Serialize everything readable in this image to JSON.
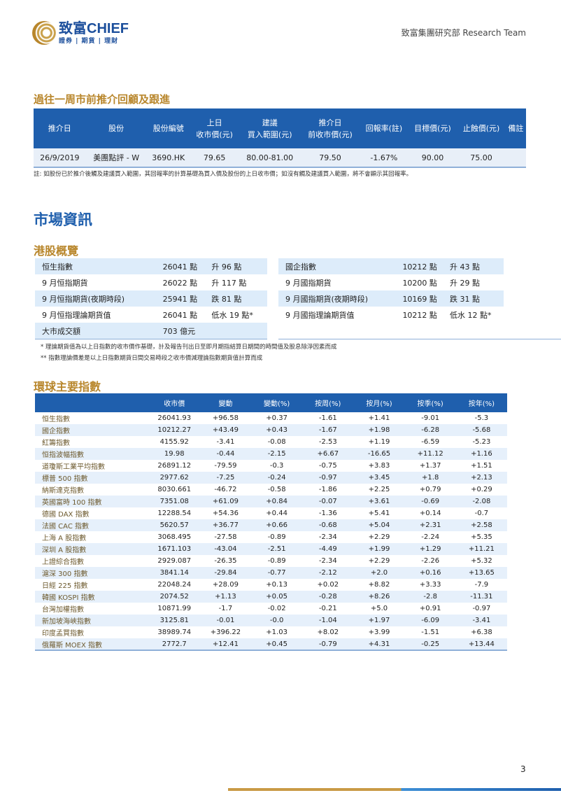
{
  "header": {
    "logo_cn": "致富",
    "logo_en": "CHIEF",
    "logo_sub": "證券 | 期貨 | 理財",
    "right": "致富集團研究部  Research Team"
  },
  "recap": {
    "title": "過往一周市前推介回顧及跟進",
    "columns": [
      "推介日",
      "股份",
      "股份編號",
      "上日\n收市價(元)",
      "建議\n買入範圍(元)",
      "推介日\n前收市價(元)",
      "回報率(註)",
      "目標價(元)",
      "止蝕價(元)",
      "備註"
    ],
    "rows": [
      [
        "26/9/2019",
        "美團點評 - W",
        "3690.HK",
        "79.65",
        "80.00-81.00",
        "79.50",
        "-1.67%",
        "90.00",
        "75.00",
        ""
      ]
    ],
    "note": "註: 如股份已於推介後觸及建議買入範圍，其回報率的計算基礎為買入價及股份的上日收市價；如沒有觸及建議買入範圍，將不會顯示其回報率。"
  },
  "market": {
    "title": "市場資訊"
  },
  "hk": {
    "title": "港股概覽",
    "left": [
      [
        "恒生指數",
        "26041 點",
        "升 96 點"
      ],
      [
        "9 月恒指期貨",
        "26022 點",
        "升 117 點"
      ],
      [
        "9 月恒指期貨(夜期時段)",
        "25941 點",
        "跌 81 點"
      ],
      [
        "9 月恒指理論期貨值",
        "26041 點",
        "低水 19 點*"
      ],
      [
        "大市成交額",
        "703 億元",
        ""
      ]
    ],
    "right": [
      [
        "國企指數",
        "10212 點",
        "升 43 點"
      ],
      [
        "9 月國指期貨",
        "10200 點",
        "升 29 點"
      ],
      [
        "9 月國指期貨(夜期時段)",
        "10169 點",
        "跌 31 點"
      ],
      [
        "9 月國指理論期貨值",
        "10212 點",
        "低水 12 點*"
      ]
    ],
    "footnotes": [
      "*  理論期貨值為以上日指數的收市價作基礎，計及報告刊出日至即月期指結算日期間的時間值及股息除淨因素而成",
      "** 指數理論價差是以上日指數期貨日間交易時段之收市價減理論指數期貨值計算而成"
    ]
  },
  "global": {
    "title": "環球主要指數",
    "columns": [
      "",
      "收市價",
      "變動",
      "變動(%)",
      "按周(%)",
      "按月(%)",
      "按季(%)",
      "按年(%)"
    ],
    "rows": [
      [
        "恒生指數",
        "26041.93",
        "+96.58",
        "+0.37",
        "-1.61",
        "+1.41",
        "-9.01",
        "-5.3"
      ],
      [
        "國企指數",
        "10212.27",
        "+43.49",
        "+0.43",
        "-1.67",
        "+1.98",
        "-6.28",
        "-5.68"
      ],
      [
        "紅籌指數",
        "4155.92",
        "-3.41",
        "-0.08",
        "-2.53",
        "+1.19",
        "-6.59",
        "-5.23"
      ],
      [
        "恒指波幅指數",
        "19.98",
        "-0.44",
        "-2.15",
        "+6.67",
        "-16.65",
        "+11.12",
        "+1.16"
      ],
      [
        "道瓊斯工業平均指數",
        "26891.12",
        "-79.59",
        "-0.3",
        "-0.75",
        "+3.83",
        "+1.37",
        "+1.51"
      ],
      [
        "標普 500 指數",
        "2977.62",
        "-7.25",
        "-0.24",
        "-0.97",
        "+3.45",
        "+1.8",
        "+2.13"
      ],
      [
        "納斯達克指數",
        "8030.661",
        "-46.72",
        "-0.58",
        "-1.86",
        "+2.25",
        "+0.79",
        "+0.29"
      ],
      [
        "英國富時 100 指數",
        "7351.08",
        "+61.09",
        "+0.84",
        "-0.07",
        "+3.61",
        "-0.69",
        "-2.08"
      ],
      [
        "德國 DAX 指數",
        "12288.54",
        "+54.36",
        "+0.44",
        "-1.36",
        "+5.41",
        "+0.14",
        "-0.7"
      ],
      [
        "法國 CAC 指數",
        "5620.57",
        "+36.77",
        "+0.66",
        "-0.68",
        "+5.04",
        "+2.31",
        "+2.58"
      ],
      [
        "上海 A 股指數",
        "3068.495",
        "-27.58",
        "-0.89",
        "-2.34",
        "+2.29",
        "-2.24",
        "+5.35"
      ],
      [
        "深圳 A 股指數",
        "1671.103",
        "-43.04",
        "-2.51",
        "-4.49",
        "+1.99",
        "+1.29",
        "+11.21"
      ],
      [
        "上證綜合指數",
        "2929.087",
        "-26.35",
        "-0.89",
        "-2.34",
        "+2.29",
        "-2.26",
        "+5.32"
      ],
      [
        "滬深 300 指數",
        "3841.14",
        "-29.84",
        "-0.77",
        "-2.12",
        "+2.0",
        "+0.16",
        "+13.65"
      ],
      [
        "日經 225 指數",
        "22048.24",
        "+28.09",
        "+0.13",
        "+0.02",
        "+8.82",
        "+3.33",
        "-7.9"
      ],
      [
        "韓國 KOSPI 指數",
        "2074.52",
        "+1.13",
        "+0.05",
        "-0.28",
        "+8.26",
        "-2.8",
        "-11.31"
      ],
      [
        "台灣加權指數",
        "10871.99",
        "-1.7",
        "-0.02",
        "-0.21",
        "+5.0",
        "+0.91",
        "-0.97"
      ],
      [
        "新加坡海峽指數",
        "3125.81",
        "-0.01",
        "-0.0",
        "-1.04",
        "+1.97",
        "-6.09",
        "-3.41"
      ],
      [
        "印度孟買指數",
        "38989.74",
        "+396.22",
        "+1.03",
        "+8.02",
        "+3.99",
        "-1.51",
        "+6.38"
      ],
      [
        "俄羅斯 MOEX 指數",
        "2772.7",
        "+12.41",
        "+0.45",
        "-0.79",
        "+4.31",
        "-0.25",
        "+13.44"
      ]
    ]
  },
  "page_number": "3",
  "colors": {
    "brand_blue": "#1f5fad",
    "gold": "#b8862b"
  }
}
